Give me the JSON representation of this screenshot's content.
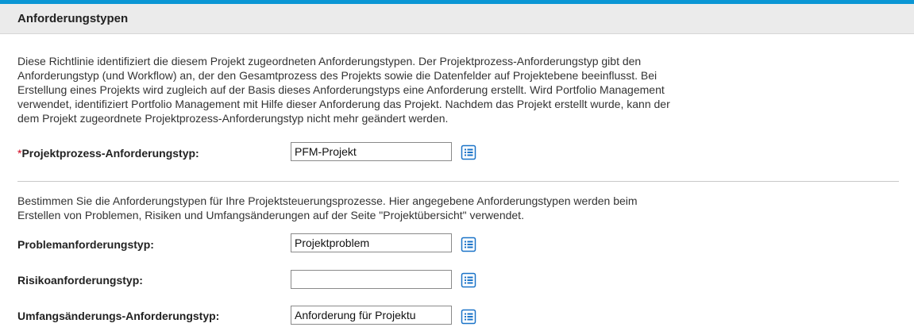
{
  "section": {
    "title": "Anforderungstypen"
  },
  "intro_text": "Diese Richtlinie identifiziert die diesem Projekt zugeordneten Anforderungstypen. Der Projektprozess-Anforderungstyp gibt den Anforderungstyp (und Workflow) an, der den Gesamtprozess des Projekts sowie die Datenfelder auf Projektebene beeinflusst. Bei Erstellung eines Projekts wird zugleich auf der Basis dieses Anforderungstyps eine Anforderung erstellt. Wird Portfolio Management verwendet, identifiziert Portfolio Management mit Hilfe dieser Anforderung das Projekt. Nachdem das Projekt erstellt wurde, kann der dem Projekt zugeordnete Projektprozess-Anforderungstyp nicht mehr geändert werden.",
  "intro_lines": [
    "Diese Richtlinie identifiziert die diesem Projekt zugeordneten Anforderungstypen. Der Projektprozess-Anforderungstyp gibt den",
    "Anforderungstyp (und Workflow) an, der den Gesamtprozess des Projekts sowie die Datenfelder auf Projektebene beeinflusst. Bei",
    "Erstellung eines Projekts wird zugleich auf der Basis dieses Anforderungstyps eine Anforderung erstellt. Wird Portfolio Management",
    "verwendet, identifiziert Portfolio Management mit Hilfe dieser Anforderung das Projekt. Nachdem das Projekt erstellt wurde, kann der",
    "dem Projekt zugeordnete Projektprozess-Anforderungstyp nicht mehr geändert werden."
  ],
  "control_lines": [
    "Bestimmen Sie die Anforderungstypen für Ihre Projektsteuerungsprozesse. Hier angegebene Anforderungstypen werden beim",
    "Erstellen von Problemen, Risiken und Umfangsänderungen auf der Seite \"Projektübersicht\" verwendet."
  ],
  "fields": {
    "project_process": {
      "required_marker": "*",
      "label": "Projektprozess-Anforderungstyp:",
      "value": "PFM-Projekt",
      "icon": "list-icon"
    },
    "problem": {
      "label": "Problemanforderungstyp:",
      "value": "Projektproblem",
      "icon": "list-icon"
    },
    "risk": {
      "label": "Risikoanforderungstyp:",
      "value": "",
      "icon": "list-icon"
    },
    "scope_change": {
      "label": "Umfangsänderungs-Anforderungstyp:",
      "value": "Anforderung für Projektu",
      "icon": "list-icon"
    }
  },
  "colors": {
    "accent_bar": "#0a96d4",
    "required_star": "#d0021b",
    "icon_blue": "#1a73c8"
  }
}
